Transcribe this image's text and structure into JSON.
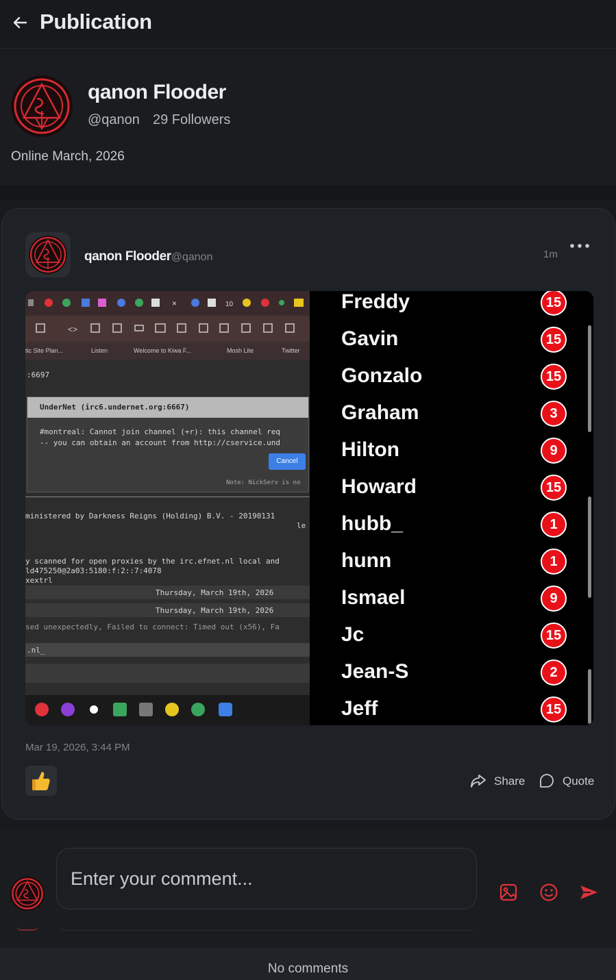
{
  "header": {
    "title": "Publication"
  },
  "profile": {
    "name": "qanon Flooder",
    "handle": "@qanon",
    "followers": "29 Followers",
    "online": "Online March, 2026"
  },
  "post": {
    "author": "qanon Flooder",
    "handle": "@qanon",
    "time": "1m",
    "date": "Mar 19, 2026, 3:44 PM",
    "share_label": "Share",
    "quote_label": "Quote",
    "screenshot": {
      "bookmarks": [
        "tic Site Plan...",
        "Listen",
        "Welcome to Kiwa F...",
        "Mosh Lite",
        "Twitter"
      ],
      "terminal": {
        "port": ":6697",
        "dialog_title": "UnderNet (irc6.undernet.org:6667)",
        "dialog_line1": "#montreal: Cannot join channel (+r): this channel req",
        "dialog_line2": "-- you can obtain an account from http://cservice.und",
        "cancel": "Cancel",
        "note": "Note: NickServ is no",
        "line_admin": "ministered by Darkness Reigns (Holding) B.V. - 20190131",
        "line_admin2": "le",
        "line_scan": "y scanned for open proxies by the irc.efnet.nl local and",
        "line_ip": "ld475250@2a03:5180:f:2::7:4078",
        "line_extrl": "xextrl",
        "date1": "Thursday, March 19th, 2026",
        "date2": "Thursday, March 19th, 2026",
        "line_err": "sed unexpectedly, Failed to connect: Timed out (x56), Fa",
        "line_nl": ".nl_"
      },
      "users": [
        {
          "nick": "Freddy",
          "count": "15"
        },
        {
          "nick": "Gavin",
          "count": "15"
        },
        {
          "nick": "Gonzalo",
          "count": "15"
        },
        {
          "nick": "Graham",
          "count": "3"
        },
        {
          "nick": "Hilton",
          "count": "9"
        },
        {
          "nick": "Howard",
          "count": "15"
        },
        {
          "nick": "hubb_",
          "count": "1"
        },
        {
          "nick": "hunn",
          "count": "1"
        },
        {
          "nick": "Ismael",
          "count": "9"
        },
        {
          "nick": "Jc",
          "count": "15"
        },
        {
          "nick": "Jean-S",
          "count": "2"
        },
        {
          "nick": "Jeff",
          "count": "15"
        }
      ]
    }
  },
  "comment": {
    "placeholder": "Enter your comment..."
  },
  "footer": {
    "no_comments": "No comments"
  },
  "icons": {
    "back": "arrow-left-icon",
    "more": "more-horizontal-icon",
    "like": "thumbs-up-icon",
    "share": "share-arrow-icon",
    "quote": "quote-bubble-icon",
    "image": "image-icon",
    "emoji": "smile-icon",
    "send": "send-icon"
  },
  "colors": {
    "accent": "#e0323a",
    "badge": "#e8111a",
    "background": "#181a1d",
    "card": "#1e2125"
  }
}
